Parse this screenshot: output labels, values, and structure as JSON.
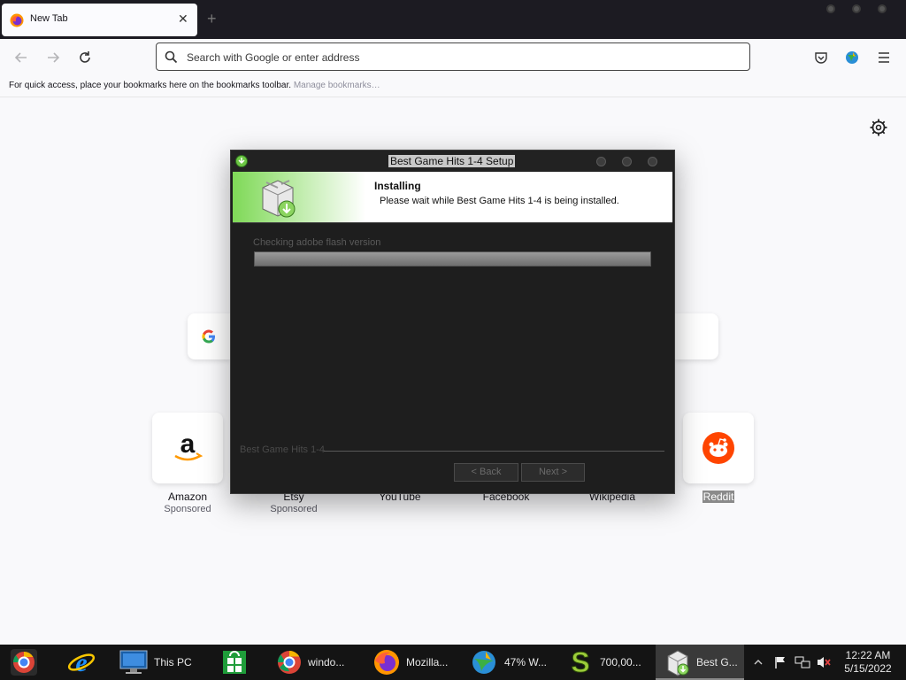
{
  "browser": {
    "tab": {
      "title": "New Tab",
      "close_glyph": "✕"
    },
    "new_tab_glyph": "+",
    "urlbar": {
      "placeholder": "Search with Google or enter address"
    },
    "bookmarks_bar": {
      "text": "For quick access, place your bookmarks here on the bookmarks toolbar.",
      "link": "Manage bookmarks…"
    }
  },
  "shortcuts": [
    {
      "label": "Amazon",
      "sub": "Sponsored",
      "icon": "amazon-icon"
    },
    {
      "label": "Etsy",
      "sub": "Sponsored",
      "icon": "etsy-icon"
    },
    {
      "label": "YouTube",
      "sub": "",
      "icon": "youtube-icon"
    },
    {
      "label": "Facebook",
      "sub": "",
      "icon": "facebook-icon"
    },
    {
      "label": "Wikipedia",
      "sub": "",
      "icon": "wikipedia-icon"
    },
    {
      "label": "Reddit",
      "sub": "",
      "icon": "reddit-icon"
    }
  ],
  "installer": {
    "title": "Best Game Hits 1-4 Setup",
    "heading": "Installing",
    "subtext": "Please wait while Best Game Hits 1-4 is being installed.",
    "status": "Checking adobe flash version",
    "progress": 1.0,
    "brand": "Best Game Hits 1-4",
    "back_label": "< Back",
    "next_label": "Next >"
  },
  "taskbar": {
    "items": [
      {
        "label": "",
        "icon": "chrome-ball-icon"
      },
      {
        "label": "",
        "icon": "internet-explorer-icon"
      },
      {
        "label": "This PC",
        "icon": "this-pc-icon"
      },
      {
        "label": "",
        "icon": "store-icon"
      },
      {
        "label": "windo...",
        "icon": "chrome-icon"
      },
      {
        "label": "Mozilla...",
        "icon": "firefox-icon"
      },
      {
        "label": "47% W...",
        "icon": "download-manager-icon"
      },
      {
        "label": "700,00...",
        "icon": "s-app-icon"
      },
      {
        "label": "Best G...",
        "icon": "installer-icon"
      }
    ],
    "clock": {
      "time": "12:22 AM",
      "date": "5/15/2022"
    }
  },
  "colors": {
    "tabstrip": "#1c1b22",
    "dialog_bg": "#1e1e1e",
    "header_green": "#7fd957",
    "taskbar": "#141414",
    "reddit": "#ff4500"
  }
}
